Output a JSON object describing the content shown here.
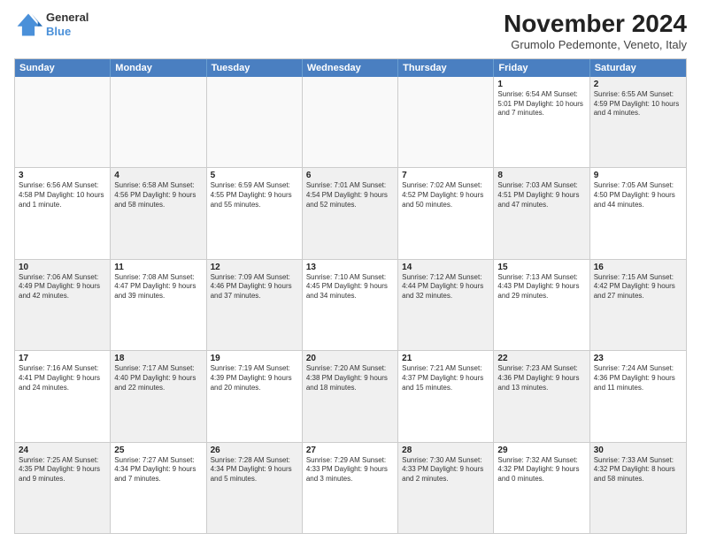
{
  "header": {
    "logo": {
      "general": "General",
      "blue": "Blue"
    },
    "title": "November 2024",
    "subtitle": "Grumolo Pedemonte, Veneto, Italy"
  },
  "weekdays": [
    "Sunday",
    "Monday",
    "Tuesday",
    "Wednesday",
    "Thursday",
    "Friday",
    "Saturday"
  ],
  "rows": [
    [
      {
        "day": "",
        "info": "",
        "empty": true
      },
      {
        "day": "",
        "info": "",
        "empty": true
      },
      {
        "day": "",
        "info": "",
        "empty": true
      },
      {
        "day": "",
        "info": "",
        "empty": true
      },
      {
        "day": "",
        "info": "",
        "empty": true
      },
      {
        "day": "1",
        "info": "Sunrise: 6:54 AM\nSunset: 5:01 PM\nDaylight: 10 hours and 7 minutes.",
        "empty": false
      },
      {
        "day": "2",
        "info": "Sunrise: 6:55 AM\nSunset: 4:59 PM\nDaylight: 10 hours and 4 minutes.",
        "empty": false,
        "shaded": true
      }
    ],
    [
      {
        "day": "3",
        "info": "Sunrise: 6:56 AM\nSunset: 4:58 PM\nDaylight: 10 hours and 1 minute.",
        "empty": false
      },
      {
        "day": "4",
        "info": "Sunrise: 6:58 AM\nSunset: 4:56 PM\nDaylight: 9 hours and 58 minutes.",
        "empty": false,
        "shaded": true
      },
      {
        "day": "5",
        "info": "Sunrise: 6:59 AM\nSunset: 4:55 PM\nDaylight: 9 hours and 55 minutes.",
        "empty": false
      },
      {
        "day": "6",
        "info": "Sunrise: 7:01 AM\nSunset: 4:54 PM\nDaylight: 9 hours and 52 minutes.",
        "empty": false,
        "shaded": true
      },
      {
        "day": "7",
        "info": "Sunrise: 7:02 AM\nSunset: 4:52 PM\nDaylight: 9 hours and 50 minutes.",
        "empty": false
      },
      {
        "day": "8",
        "info": "Sunrise: 7:03 AM\nSunset: 4:51 PM\nDaylight: 9 hours and 47 minutes.",
        "empty": false,
        "shaded": true
      },
      {
        "day": "9",
        "info": "Sunrise: 7:05 AM\nSunset: 4:50 PM\nDaylight: 9 hours and 44 minutes.",
        "empty": false
      }
    ],
    [
      {
        "day": "10",
        "info": "Sunrise: 7:06 AM\nSunset: 4:49 PM\nDaylight: 9 hours and 42 minutes.",
        "empty": false,
        "shaded": true
      },
      {
        "day": "11",
        "info": "Sunrise: 7:08 AM\nSunset: 4:47 PM\nDaylight: 9 hours and 39 minutes.",
        "empty": false
      },
      {
        "day": "12",
        "info": "Sunrise: 7:09 AM\nSunset: 4:46 PM\nDaylight: 9 hours and 37 minutes.",
        "empty": false,
        "shaded": true
      },
      {
        "day": "13",
        "info": "Sunrise: 7:10 AM\nSunset: 4:45 PM\nDaylight: 9 hours and 34 minutes.",
        "empty": false
      },
      {
        "day": "14",
        "info": "Sunrise: 7:12 AM\nSunset: 4:44 PM\nDaylight: 9 hours and 32 minutes.",
        "empty": false,
        "shaded": true
      },
      {
        "day": "15",
        "info": "Sunrise: 7:13 AM\nSunset: 4:43 PM\nDaylight: 9 hours and 29 minutes.",
        "empty": false
      },
      {
        "day": "16",
        "info": "Sunrise: 7:15 AM\nSunset: 4:42 PM\nDaylight: 9 hours and 27 minutes.",
        "empty": false,
        "shaded": true
      }
    ],
    [
      {
        "day": "17",
        "info": "Sunrise: 7:16 AM\nSunset: 4:41 PM\nDaylight: 9 hours and 24 minutes.",
        "empty": false
      },
      {
        "day": "18",
        "info": "Sunrise: 7:17 AM\nSunset: 4:40 PM\nDaylight: 9 hours and 22 minutes.",
        "empty": false,
        "shaded": true
      },
      {
        "day": "19",
        "info": "Sunrise: 7:19 AM\nSunset: 4:39 PM\nDaylight: 9 hours and 20 minutes.",
        "empty": false
      },
      {
        "day": "20",
        "info": "Sunrise: 7:20 AM\nSunset: 4:38 PM\nDaylight: 9 hours and 18 minutes.",
        "empty": false,
        "shaded": true
      },
      {
        "day": "21",
        "info": "Sunrise: 7:21 AM\nSunset: 4:37 PM\nDaylight: 9 hours and 15 minutes.",
        "empty": false
      },
      {
        "day": "22",
        "info": "Sunrise: 7:23 AM\nSunset: 4:36 PM\nDaylight: 9 hours and 13 minutes.",
        "empty": false,
        "shaded": true
      },
      {
        "day": "23",
        "info": "Sunrise: 7:24 AM\nSunset: 4:36 PM\nDaylight: 9 hours and 11 minutes.",
        "empty": false
      }
    ],
    [
      {
        "day": "24",
        "info": "Sunrise: 7:25 AM\nSunset: 4:35 PM\nDaylight: 9 hours and 9 minutes.",
        "empty": false,
        "shaded": true
      },
      {
        "day": "25",
        "info": "Sunrise: 7:27 AM\nSunset: 4:34 PM\nDaylight: 9 hours and 7 minutes.",
        "empty": false
      },
      {
        "day": "26",
        "info": "Sunrise: 7:28 AM\nSunset: 4:34 PM\nDaylight: 9 hours and 5 minutes.",
        "empty": false,
        "shaded": true
      },
      {
        "day": "27",
        "info": "Sunrise: 7:29 AM\nSunset: 4:33 PM\nDaylight: 9 hours and 3 minutes.",
        "empty": false
      },
      {
        "day": "28",
        "info": "Sunrise: 7:30 AM\nSunset: 4:33 PM\nDaylight: 9 hours and 2 minutes.",
        "empty": false,
        "shaded": true
      },
      {
        "day": "29",
        "info": "Sunrise: 7:32 AM\nSunset: 4:32 PM\nDaylight: 9 hours and 0 minutes.",
        "empty": false
      },
      {
        "day": "30",
        "info": "Sunrise: 7:33 AM\nSunset: 4:32 PM\nDaylight: 8 hours and 58 minutes.",
        "empty": false,
        "shaded": true
      }
    ]
  ]
}
